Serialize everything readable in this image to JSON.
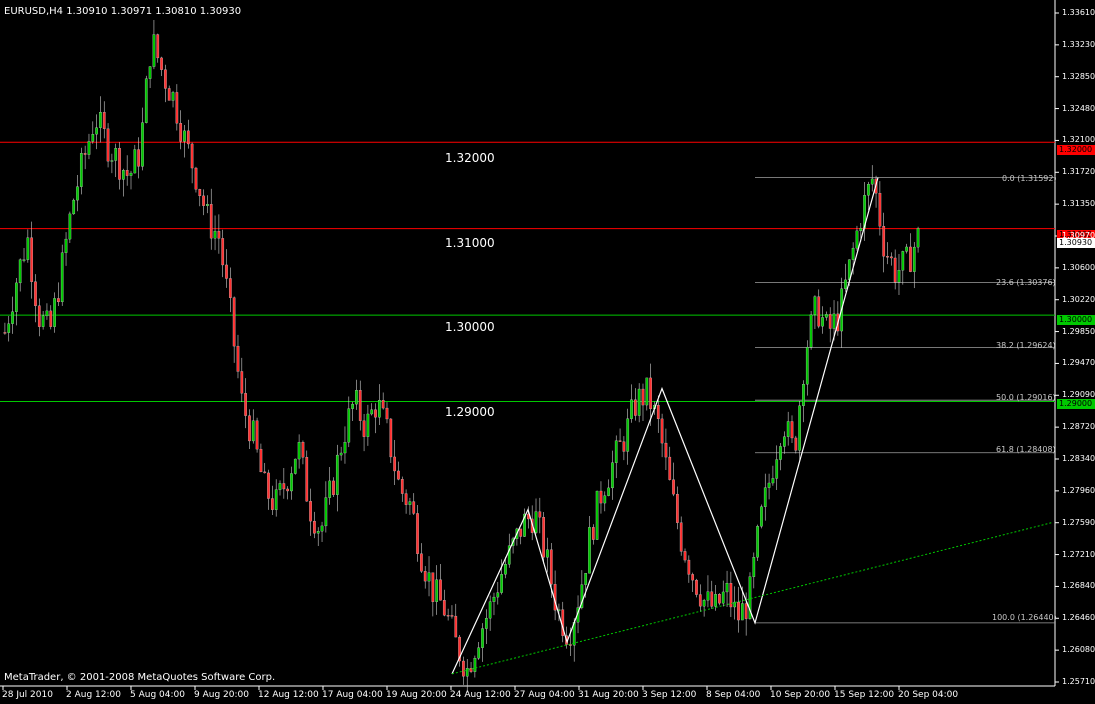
{
  "window": {
    "symbol_line": "EURUSD,H4  1.30910 1.30971 1.30810 1.30930",
    "copyright": "MetaTrader, © 2001-2008 MetaQuotes Software Corp."
  },
  "levels": [
    {
      "label": "1.32000",
      "price": 1.32,
      "color": "#ff0000"
    },
    {
      "label": "1.31000",
      "price": 1.31,
      "color": "#ff0000"
    },
    {
      "label": "1.30000",
      "price": 1.3,
      "color": "#00c800"
    },
    {
      "label": "1.29000",
      "price": 1.29,
      "color": "#00c800"
    }
  ],
  "price_tags": [
    {
      "label": "1.32000",
      "price": 1.32,
      "color": "#ff0000"
    },
    {
      "label": "1.31000",
      "price": 1.31,
      "color": "#ff0000"
    },
    {
      "label": "1.30930",
      "price": 1.3093,
      "color": "#ffffff"
    },
    {
      "label": "1.30000",
      "price": 1.3,
      "color": "#00c800"
    },
    {
      "label": "1.29000",
      "price": 1.29,
      "color": "#00c800"
    }
  ],
  "fibonacci": [
    {
      "label": "0.0 (1.31592)",
      "price": 1.31592
    },
    {
      "label": "23.6 (1.30376)",
      "price": 1.30376
    },
    {
      "label": "38.2 (1.29624)",
      "price": 1.29624
    },
    {
      "label": "50.0 (1.29016)",
      "price": 1.29016
    },
    {
      "label": "61.8 (1.28408)",
      "price": 1.28408
    },
    {
      "label": "100.0 (1.26440)",
      "price": 1.2644
    }
  ],
  "y_axis": [
    "1.33610",
    "1.33230",
    "1.32850",
    "1.32480",
    "1.32100",
    "1.31720",
    "1.31350",
    "1.30970",
    "1.30600",
    "1.30220",
    "1.29850",
    "1.29470",
    "1.29090",
    "1.28720",
    "1.28340",
    "1.27960",
    "1.27590",
    "1.27210",
    "1.26840",
    "1.26460",
    "1.26080",
    "1.25710"
  ],
  "x_axis": [
    "28 Jul 2010",
    "2 Aug 12:00",
    "5 Aug 04:00",
    "9 Aug 20:00",
    "12 Aug 12:00",
    "17 Aug 04:00",
    "19 Aug 20:00",
    "24 Aug 12:00",
    "27 Aug 04:00",
    "31 Aug 20:00",
    "3 Sep 12:00",
    "8 Sep 04:00",
    "10 Sep 20:00",
    "15 Sep 12:00",
    "20 Sep 04:00"
  ],
  "chart_data": {
    "type": "candlestick",
    "symbol": "EURUSD",
    "timeframe": "H4",
    "ohlc_last": {
      "open": 1.3091,
      "high": 1.30971,
      "low": 1.3081,
      "close": 1.3093
    },
    "y_range": [
      1.2571,
      1.3361
    ],
    "price_path": [
      1.298,
      1.304,
      1.309,
      1.3,
      1.298,
      1.305,
      1.313,
      1.318,
      1.323,
      1.32,
      1.318,
      1.316,
      1.319,
      1.332,
      1.328,
      1.325,
      1.32,
      1.316,
      1.311,
      1.309,
      1.3,
      1.29,
      1.286,
      1.28,
      1.278,
      1.281,
      1.285,
      1.278,
      1.275,
      1.28,
      1.286,
      1.29,
      1.287,
      1.29,
      1.286,
      1.28,
      1.278,
      1.272,
      1.268,
      1.266,
      1.262,
      1.259,
      1.263,
      1.266,
      1.27,
      1.273,
      1.276,
      1.277,
      1.272,
      1.266,
      1.263,
      1.268,
      1.275,
      1.28,
      1.283,
      1.286,
      1.29,
      1.291,
      1.287,
      1.28,
      1.274,
      1.27,
      1.267,
      1.266,
      1.268,
      1.265,
      1.267,
      1.276,
      1.282,
      1.288,
      1.284,
      1.296,
      1.301,
      1.298,
      1.3,
      1.306,
      1.312,
      1.316,
      1.308,
      1.305,
      1.306,
      1.309
    ],
    "zigzag": [
      [
        1.2585
      ],
      [
        1.2775
      ],
      [
        1.2622
      ],
      [
        1.2915
      ],
      [
        1.2644
      ],
      [
        1.3159
      ]
    ],
    "trendline": {
      "from": 1.2585,
      "to": 1.276,
      "color": "#00c800",
      "style": "dotted"
    }
  }
}
